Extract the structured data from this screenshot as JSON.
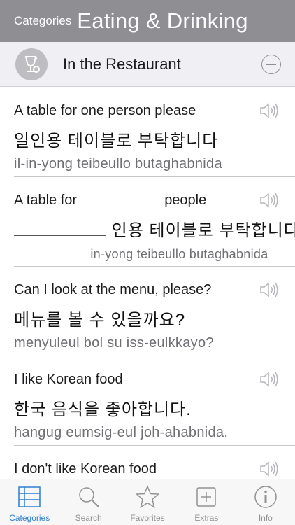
{
  "header": {
    "back_label": "Categories",
    "title": "Eating & Drinking"
  },
  "section": {
    "label": "In the Restaurant",
    "icon": "wine-glass-icon",
    "toggle_icon": "minus-circle-icon"
  },
  "phrases": [
    {
      "english": "A table for one person please",
      "korean": "일인용 테이블로 부탁합니다",
      "romanization": "il-in-yong teibeullo butaghabnida"
    },
    {
      "english_before": "A table for",
      "english_after": "people",
      "korean": "인용 테이블로 부탁합니다",
      "romanization": "in-yong teibeullo butaghabnida"
    },
    {
      "english": "Can I look at the menu, please?",
      "korean": "메뉴를 볼 수 있을까요?",
      "romanization": "menyuleul bol su iss-eulkkayo?"
    },
    {
      "english": "I like Korean food",
      "korean": "한국 음식을 좋아합니다.",
      "romanization": "hangug eumsig-eul joh-ahabnida."
    },
    {
      "english": "I don't like Korean food",
      "korean": "",
      "romanization": ""
    }
  ],
  "tabs": [
    {
      "label": "Categories",
      "icon": "list-icon",
      "active": true
    },
    {
      "label": "Search",
      "icon": "magnifier-icon",
      "active": false
    },
    {
      "label": "Favorites",
      "icon": "star-icon",
      "active": false
    },
    {
      "label": "Extras",
      "icon": "plus-square-icon",
      "active": false
    },
    {
      "label": "Info",
      "icon": "info-circle-icon",
      "active": false
    }
  ],
  "colors": {
    "header_bg": "#8e8e93",
    "section_bg": "#efeff4",
    "tab_active": "#2f7fd1",
    "tab_inactive": "#929292"
  }
}
